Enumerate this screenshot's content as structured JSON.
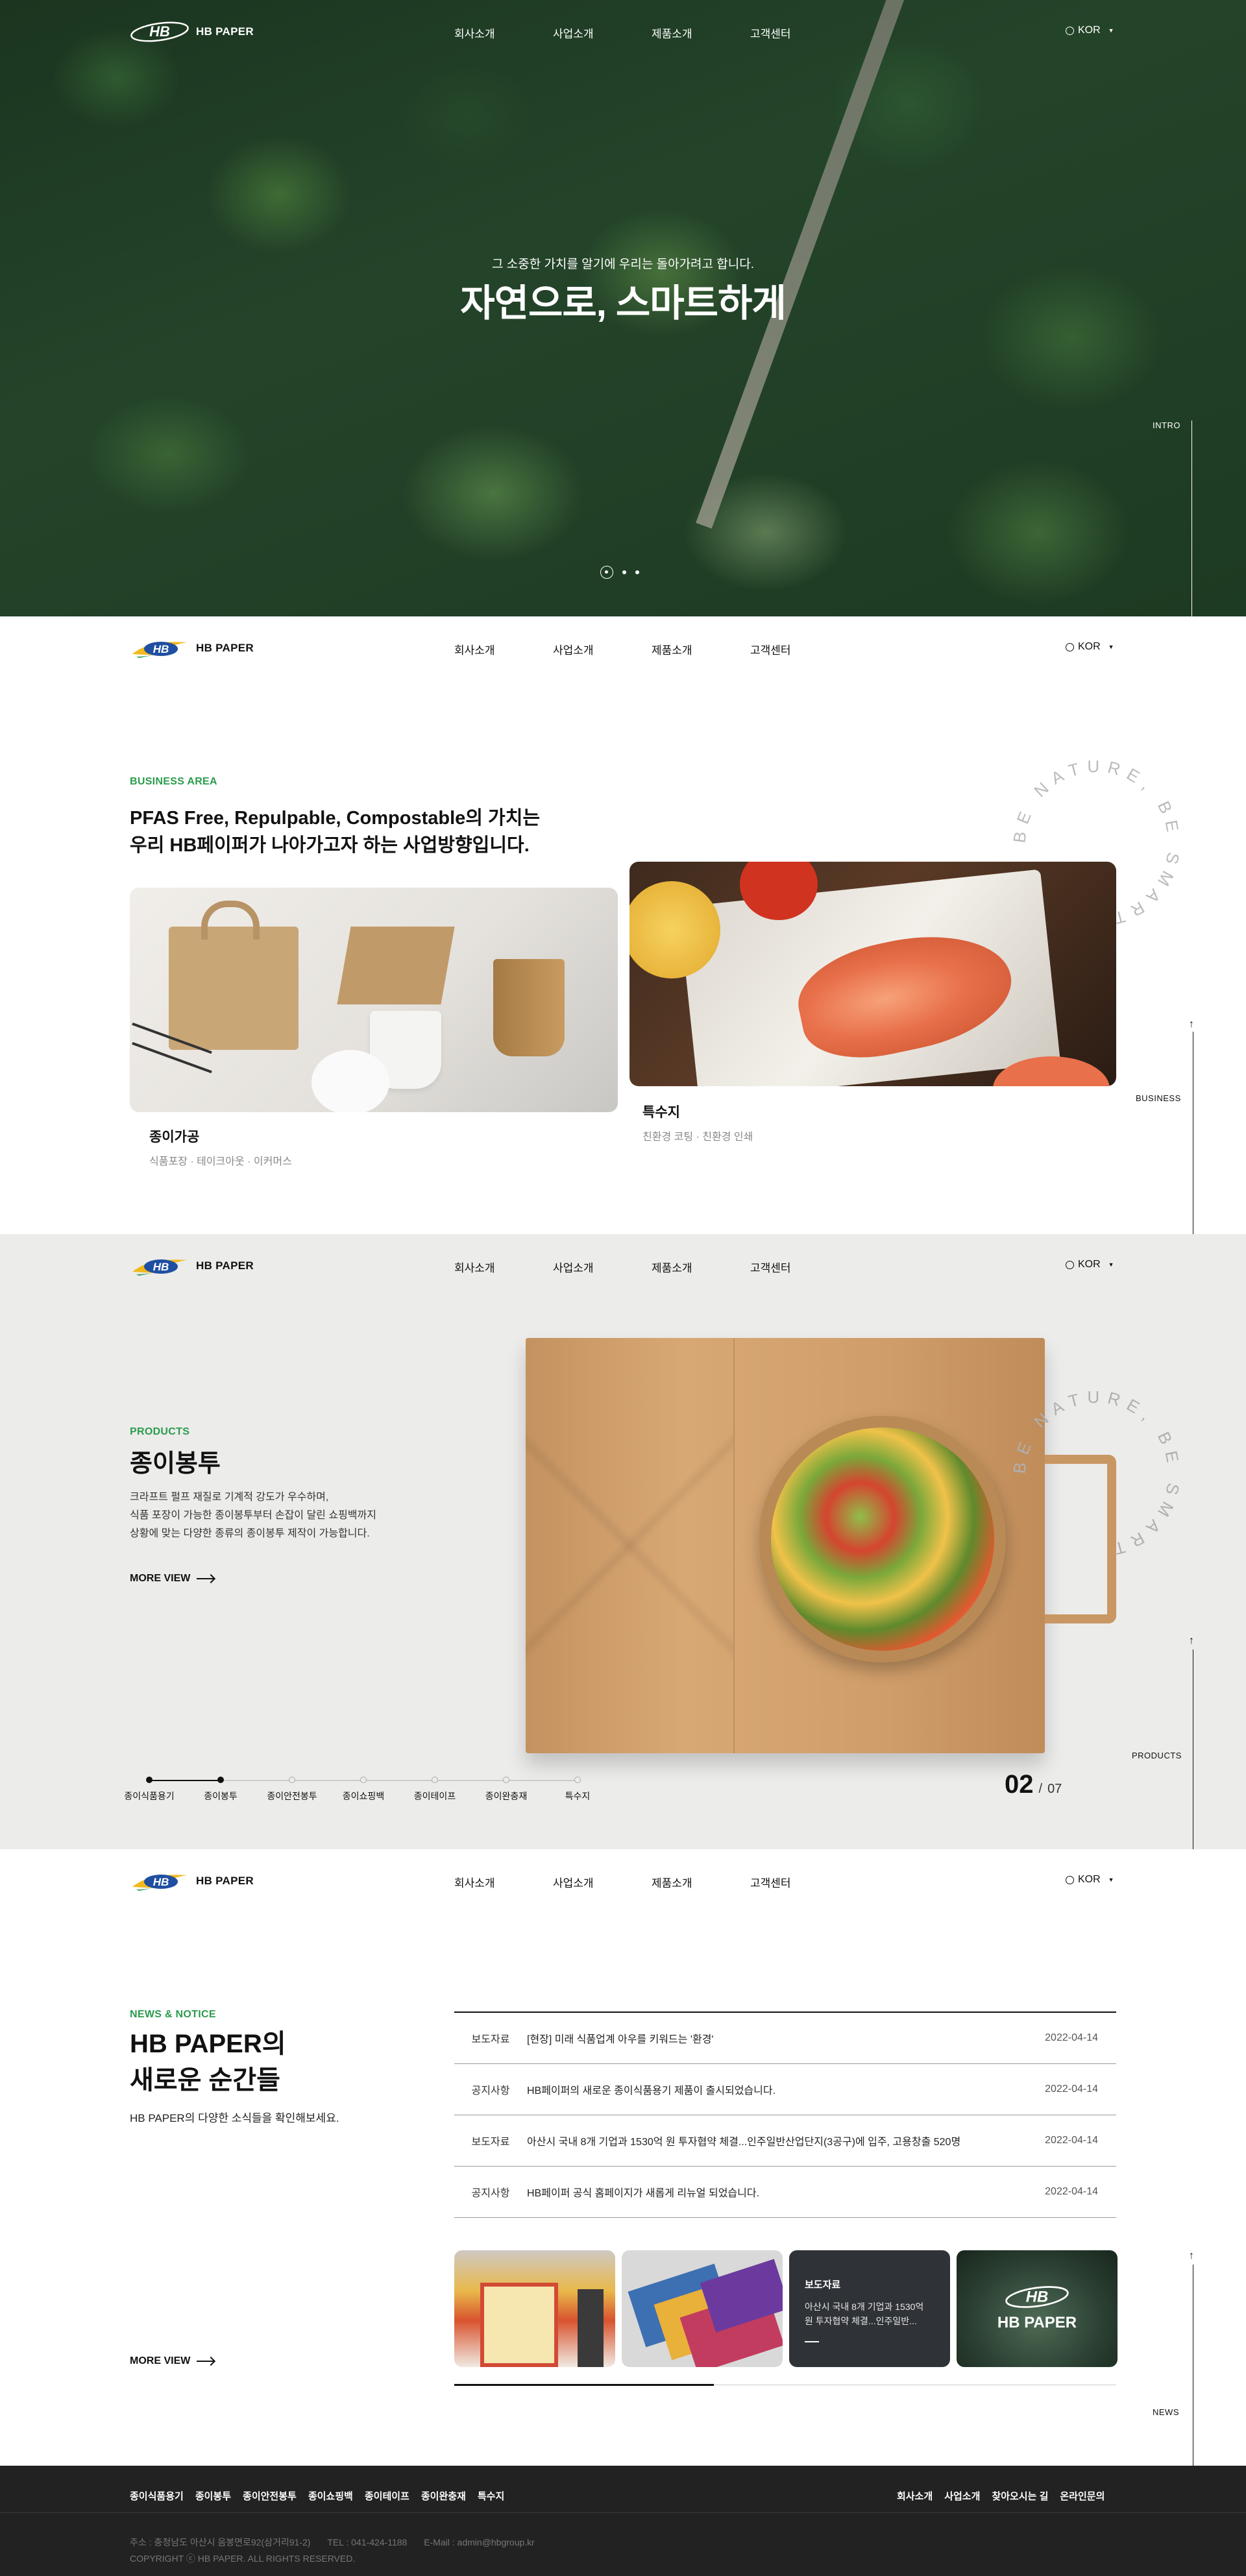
{
  "brand": {
    "name": "HB PAPER",
    "mark_text": "HB"
  },
  "nav": [
    "회사소개",
    "사업소개",
    "제품소개",
    "고객센터"
  ],
  "lang": "KOR",
  "hero": {
    "subtitle": "그 소중한 가치를 알기에 우리는 돌아가려고 합니다.",
    "title": "자연으로, 스마트하게",
    "side_label": "INTRO",
    "slides": 3,
    "active_slide": 1
  },
  "business": {
    "eyebrow": "BUSINESS AREA",
    "title_line1": "PFAS Free, Repulpable, Compostable의 가치는",
    "title_line2": "우리 HB페이퍼가 나아가고자 하는 사업방향입니다.",
    "circle_text": "BE NATURE, BE SMART",
    "side_label": "BUSINESS",
    "cards": [
      {
        "name": "종이가공",
        "tags": "식품포장 · 테이크아웃 · 이커머스"
      },
      {
        "name": "특수지",
        "tags": "친환경 코팅 · 친환경 인쇄"
      }
    ]
  },
  "products": {
    "eyebrow": "PRODUCTS",
    "title": "종이봉투",
    "desc": [
      "크라프트 펄프 재질로 기계적 강도가 우수하며,",
      "식품 포장이 가능한 종이봉투부터 손잡이 달린 쇼핑백까지",
      "상황에 맞는 다양한 종류의 종이봉투 제작이 가능합니다."
    ],
    "more": "MORE VIEW",
    "side_label": "PRODUCTS",
    "timeline": [
      "종이식품용기",
      "종이봉투",
      "종이안전봉투",
      "종이쇼핑백",
      "종이테이프",
      "종이완충재",
      "특수지"
    ],
    "current": "02",
    "total": "07"
  },
  "news": {
    "eyebrow": "NEWS & NOTICE",
    "title_line1": "HB PAPER의",
    "title_line2": "새로운 순간들",
    "subtitle": "HB PAPER의 다양한 소식들을 확인해보세요.",
    "more": "MORE VIEW",
    "side_label": "NEWS",
    "rows": [
      {
        "cat": "보도자료",
        "text": "[현장] 미래 식품업계 아우를 키워드는 '환경'",
        "date": "2022-04-14"
      },
      {
        "cat": "공지사항",
        "text": "HB페이퍼의 새로운 종이식품용기 제품이 출시되었습니다.",
        "date": "2022-04-14"
      },
      {
        "cat": "보도자료",
        "text": "아산시 국내 8개 기업과 1530억 원 투자협약 체결...인주일반산업단지(3공구)에 입주, 고용창출 520명",
        "date": "2022-04-14"
      },
      {
        "cat": "공지사항",
        "text": "HB페이퍼 공식 홈페이지가 새롭게 리뉴얼 되었습니다.",
        "date": "2022-04-14"
      }
    ],
    "thumb_overlay": {
      "cat": "보도자료",
      "text_line1": "아산시 국내 8개 기업과 1530억",
      "text_line2": "원 투자협약 체결...인주일반..."
    },
    "thumb_logo": "HB PAPER"
  },
  "footer": {
    "left_links": [
      "종이식품용기",
      "종이봉투",
      "종이안전봉투",
      "종이쇼핑백",
      "종이테이프",
      "종이완충재",
      "특수지"
    ],
    "right_links": [
      "회사소개",
      "사업소개",
      "찾아오시는 길",
      "온라인문의"
    ],
    "address": "주소 : 충청남도 아산시 음봉면로92(삼거리91-2)",
    "tel": "TEL : 041-424-1188",
    "email": "E-Mail : admin@hbgroup.kr",
    "copyright": "COPYRIGHT ⓒ HB PAPER. ALL RIGHTS RESERVED."
  },
  "colors": {
    "accent_green": "#2b9c4d",
    "footer_bg": "#222222",
    "products_bg": "#ececeb"
  }
}
